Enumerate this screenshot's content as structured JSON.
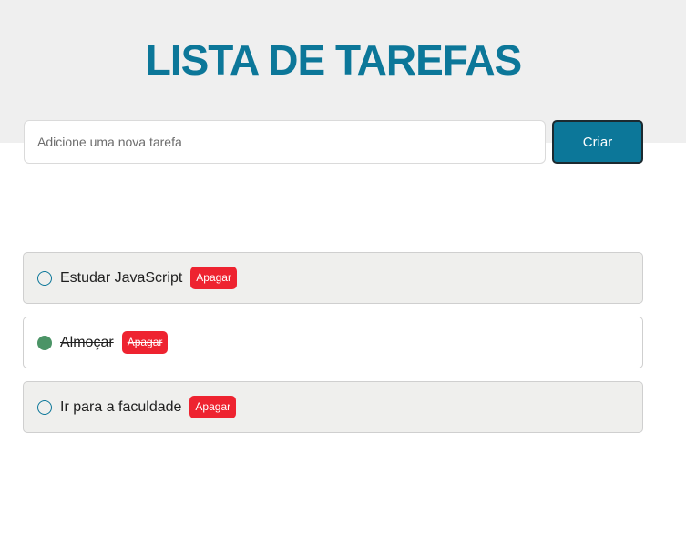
{
  "header": {
    "title": "LISTA DE TAREFAS"
  },
  "new_task": {
    "placeholder": "Adicione uma nova tarefa",
    "value": "",
    "create_label": "Criar"
  },
  "tasks": [
    {
      "text": "Estudar JavaScript",
      "completed": false,
      "delete_label": "Apagar"
    },
    {
      "text": "Almoçar",
      "completed": true,
      "delete_label": "Apagar"
    },
    {
      "text": "Ir para a faculdade",
      "completed": false,
      "delete_label": "Apagar"
    }
  ],
  "colors": {
    "accent": "#0c7799",
    "header_background": "#efefef",
    "delete": "#ee2330",
    "completed_check": "#4b9466"
  }
}
